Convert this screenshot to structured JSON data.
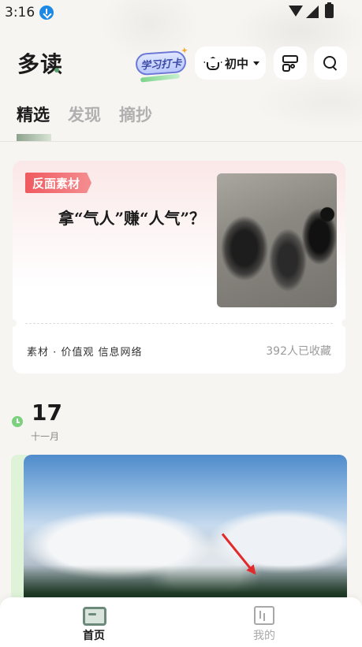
{
  "status_bar": {
    "time": "3:16"
  },
  "header": {
    "logo": "多读",
    "study_badge": "学习打卡",
    "grade": "初中"
  },
  "tabs": [
    {
      "label": "精选",
      "active": true
    },
    {
      "label": "发现",
      "active": false
    },
    {
      "label": "摘抄",
      "active": false
    }
  ],
  "featured_card": {
    "tag": "反面素材",
    "title": "拿“气人”赚“人气”？",
    "meta": "素材 · 价值观 信息网络",
    "count": "392人已收藏",
    "accent_color": "#ef5a5f"
  },
  "daily": {
    "day": "17",
    "month": "十一月",
    "accent_color": "#7cd17f"
  },
  "bottom_nav": [
    {
      "label": "首页",
      "icon": "home-icon",
      "active": true
    },
    {
      "label": "我的",
      "icon": "mine-icon",
      "active": false
    }
  ]
}
